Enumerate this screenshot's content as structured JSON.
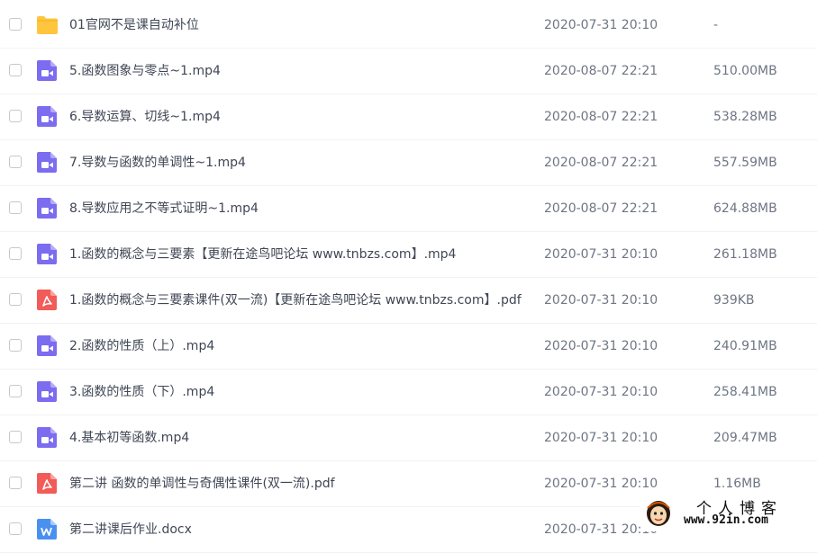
{
  "files": [
    {
      "name": "01官网不是课自动补位",
      "date": "2020-07-31 20:10",
      "size": "-",
      "icon": "folder-icon"
    },
    {
      "name": "5.函数图象与零点~1.mp4",
      "date": "2020-08-07 22:21",
      "size": "510.00MB",
      "icon": "video-icon"
    },
    {
      "name": "6.导数运算、切线~1.mp4",
      "date": "2020-08-07 22:21",
      "size": "538.28MB",
      "icon": "video-icon"
    },
    {
      "name": "7.导数与函数的单调性~1.mp4",
      "date": "2020-08-07 22:21",
      "size": "557.59MB",
      "icon": "video-icon"
    },
    {
      "name": "8.导数应用之不等式证明~1.mp4",
      "date": "2020-08-07 22:21",
      "size": "624.88MB",
      "icon": "video-icon"
    },
    {
      "name": "1.函数的概念与三要素【更新在途鸟吧论坛 www.tnbzs.com】.mp4",
      "date": "2020-07-31 20:10",
      "size": "261.18MB",
      "icon": "video-icon"
    },
    {
      "name": "1.函数的概念与三要素课件(双一流)【更新在途鸟吧论坛 www.tnbzs.com】.pdf",
      "date": "2020-07-31 20:10",
      "size": "939KB",
      "icon": "pdf-icon"
    },
    {
      "name": "2.函数的性质（上）.mp4",
      "date": "2020-07-31 20:10",
      "size": "240.91MB",
      "icon": "video-icon"
    },
    {
      "name": "3.函数的性质（下）.mp4",
      "date": "2020-07-31 20:10",
      "size": "258.41MB",
      "icon": "video-icon"
    },
    {
      "name": "4.基本初等函数.mp4",
      "date": "2020-07-31 20:10",
      "size": "209.47MB",
      "icon": "video-icon"
    },
    {
      "name": "第二讲 函数的单调性与奇偶性课件(双一流).pdf",
      "date": "2020-07-31 20:10",
      "size": "1.16MB",
      "icon": "pdf-icon"
    },
    {
      "name": "第二讲课后作业.docx",
      "date": "2020-07-31 20:10",
      "size": "",
      "icon": "word-icon"
    }
  ],
  "watermark": {
    "title": "个人博客",
    "url": "www.92in.com"
  },
  "colors": {
    "folder": "#ffc53d",
    "video": "#7b6cf0",
    "pdf": "#f25b57",
    "word": "#4a90ef"
  }
}
